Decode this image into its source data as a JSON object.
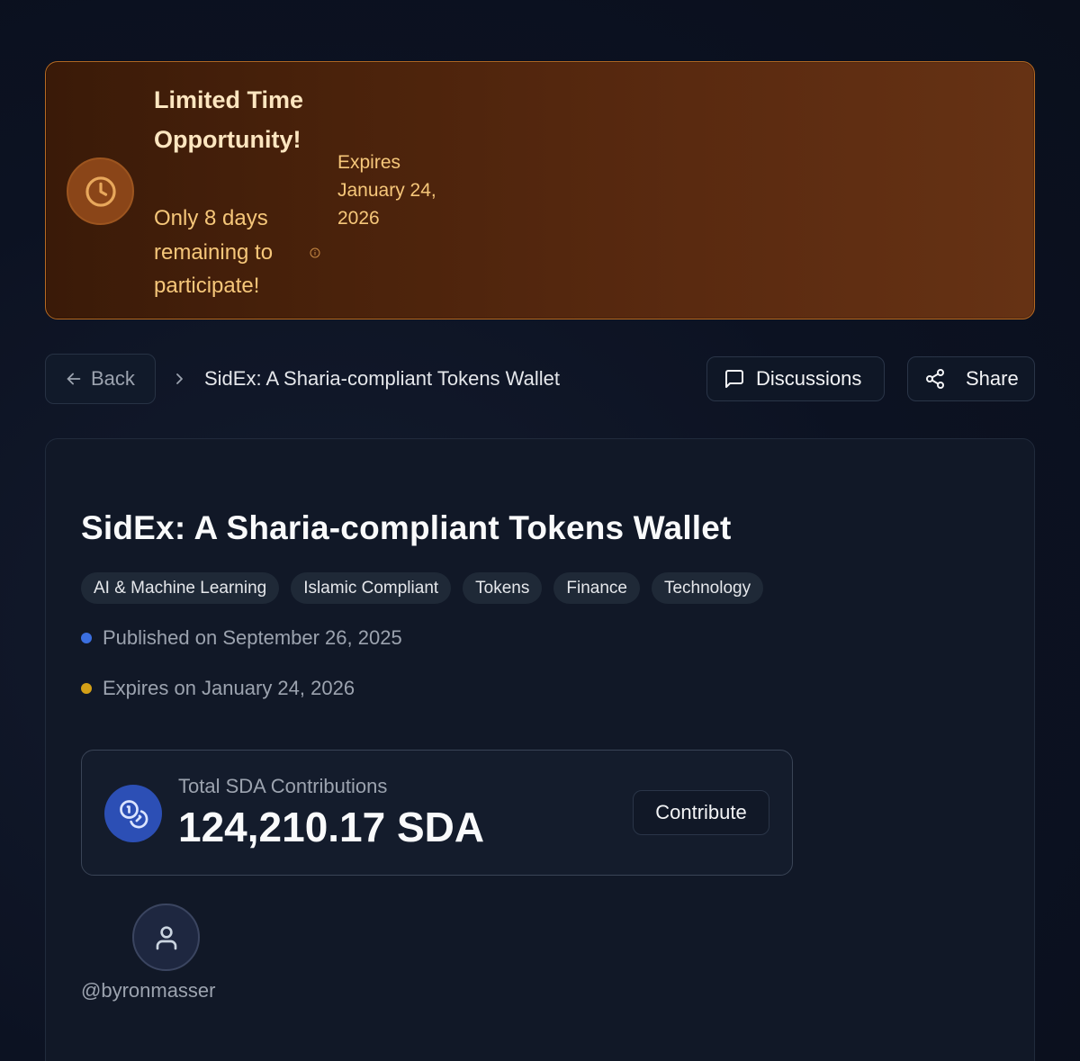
{
  "banner": {
    "title": "Limited Time Opportunity!",
    "subtitle": "Only 8 days remaining to participate!",
    "expires": "Expires January 24, 2026",
    "icon": "clock-icon"
  },
  "nav": {
    "back_label": "Back",
    "breadcrumb_current": "SidEx: A Sharia-compliant Tokens Wallet",
    "discussions_label": "Discussions",
    "share_label": "Share"
  },
  "project": {
    "title": "SidEx: A Sharia-compliant Tokens Wallet",
    "tags": [
      "AI & Machine Learning",
      "Islamic Compliant",
      "Tokens",
      "Finance",
      "Technology"
    ],
    "published": "Published on September 26, 2025",
    "expires": "Expires on January 24, 2026",
    "published_dot_color": "#3b6fe0",
    "expires_dot_color": "#d4a017"
  },
  "contributions": {
    "label": "Total SDA Contributions",
    "value": "124,210.17 SDA",
    "button_label": "Contribute",
    "icon": "coins-icon"
  },
  "author": {
    "username": "@byronmasser",
    "icon": "user-icon"
  }
}
